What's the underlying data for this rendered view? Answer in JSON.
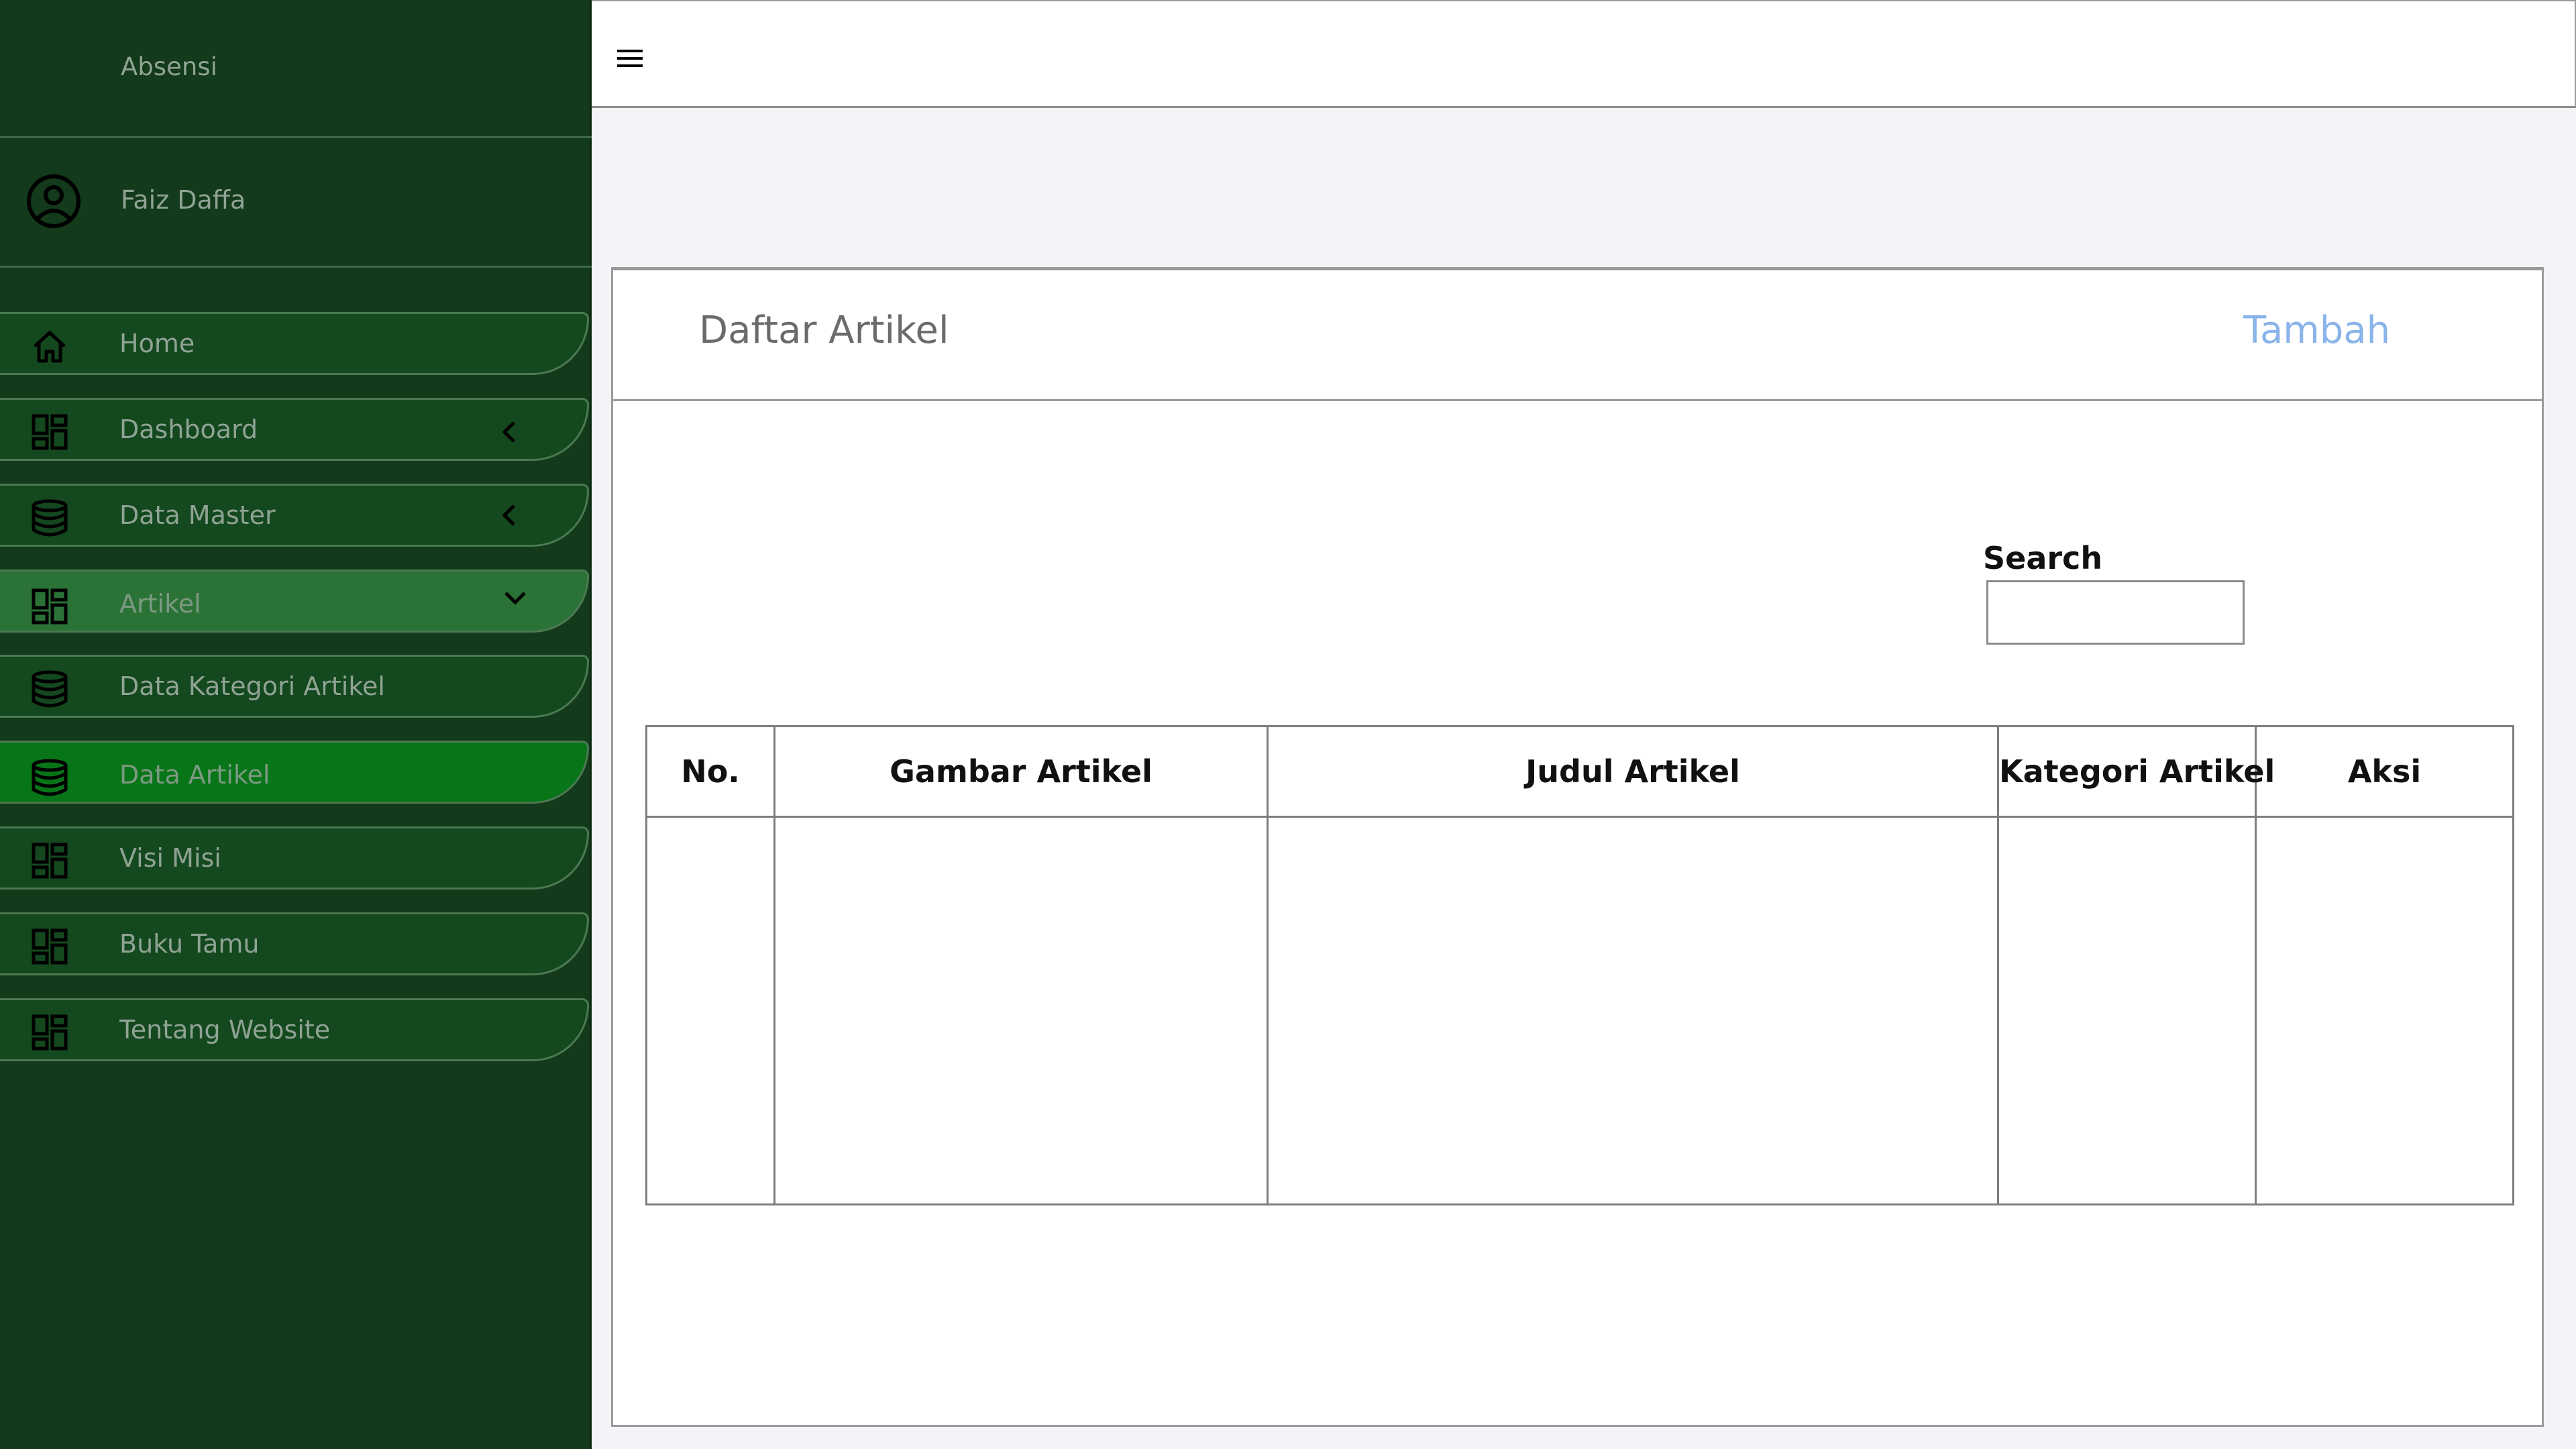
{
  "brand": {
    "title": "Absensi"
  },
  "user": {
    "name": "Faiz Daffa",
    "icon": "user-circle-icon"
  },
  "sidebar": {
    "items": [
      {
        "label": "Home",
        "icon": "home-icon",
        "chevron": ""
      },
      {
        "label": "Dashboard",
        "icon": "dashboard-icon",
        "chevron": "chevron-left-icon"
      },
      {
        "label": "Data Master",
        "icon": "database-icon",
        "chevron": "chevron-left-icon"
      },
      {
        "label": "Artikel",
        "icon": "dashboard-icon",
        "chevron": "chevron-down-icon"
      },
      {
        "label": "Data Kategori Artikel",
        "icon": "database-icon",
        "chevron": ""
      },
      {
        "label": "Data Artikel",
        "icon": "database-icon",
        "chevron": ""
      },
      {
        "label": "Visi Misi",
        "icon": "dashboard-icon",
        "chevron": ""
      },
      {
        "label": "Buku Tamu",
        "icon": "dashboard-icon",
        "chevron": ""
      },
      {
        "label": "Tentang Website",
        "icon": "dashboard-icon",
        "chevron": ""
      }
    ]
  },
  "topbar": {
    "menu_icon": "hamburger-menu-icon"
  },
  "card": {
    "title": "Daftar Artikel",
    "add_label": "Tambah"
  },
  "search": {
    "label": "Search",
    "value": ""
  },
  "table": {
    "columns": [
      "No.",
      "Gambar Artikel",
      "Judul Artikel",
      "Kategori Artikel",
      "Aksi"
    ],
    "rows": []
  },
  "colors": {
    "sidebar_bg": "#133a1a",
    "menu_item_bg": "#14481e",
    "menu_item_expanded_bg": "#2b7237",
    "menu_item_selected_bg": "#097519",
    "accent_link": "#8ab4ea"
  }
}
